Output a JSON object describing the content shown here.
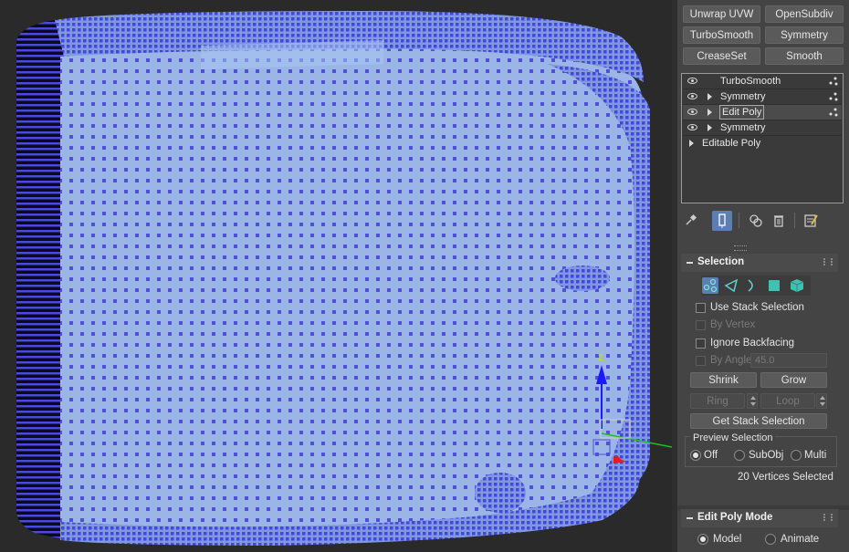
{
  "modifier_buttons": [
    "Unwrap UVW",
    "OpenSubdiv",
    "TurboSmooth",
    "Symmetry",
    "CreaseSet",
    "Smooth"
  ],
  "modifier_stack": [
    {
      "label": "TurboSmooth",
      "expandable": false,
      "visible": true,
      "selected": false
    },
    {
      "label": "Symmetry",
      "expandable": true,
      "visible": true,
      "selected": false
    },
    {
      "label": "Edit Poly",
      "expandable": true,
      "visible": true,
      "selected": true
    },
    {
      "label": "Symmetry",
      "expandable": true,
      "visible": true,
      "selected": false
    },
    {
      "label": "Editable Poly",
      "expandable": true,
      "visible": false,
      "selected": false
    }
  ],
  "stack_tools": [
    "pin-stack-icon",
    "show-end-result-icon",
    "make-unique-icon",
    "remove-modifier-icon",
    "configure-sets-icon"
  ],
  "selection_rollout": {
    "title": "Selection",
    "subobject_levels": [
      "vertex-icon",
      "edge-icon",
      "border-icon",
      "polygon-icon",
      "element-icon"
    ],
    "active_level": "vertex-icon",
    "use_stack_selection": "Use Stack Selection",
    "by_vertex": "By Vertex",
    "ignore_backfacing": "Ignore Backfacing",
    "by_angle_label": "By Angle:",
    "by_angle_value": "45.0",
    "shrink": "Shrink",
    "grow": "Grow",
    "ring": "Ring",
    "loop": "Loop",
    "get_stack_selection": "Get Stack Selection",
    "preview_selection": {
      "title": "Preview Selection",
      "options": [
        "Off",
        "SubObj",
        "Multi"
      ],
      "selected": "Off"
    },
    "status": "20 Vertices Selected"
  },
  "edit_poly_mode_rollout": {
    "title": "Edit Poly Mode",
    "options": [
      "Model",
      "Animate"
    ],
    "selected": "Model"
  },
  "viewport": {
    "gizmo_axis_label": "Z",
    "colors": {
      "background": "#2a2a2a",
      "mesh_fill": "#9ab6e6",
      "vertex": "#5555ee",
      "gizmo_z": "#1a1aff",
      "gizmo_x": "#e02020",
      "gizmo_y": "#20c020"
    }
  }
}
